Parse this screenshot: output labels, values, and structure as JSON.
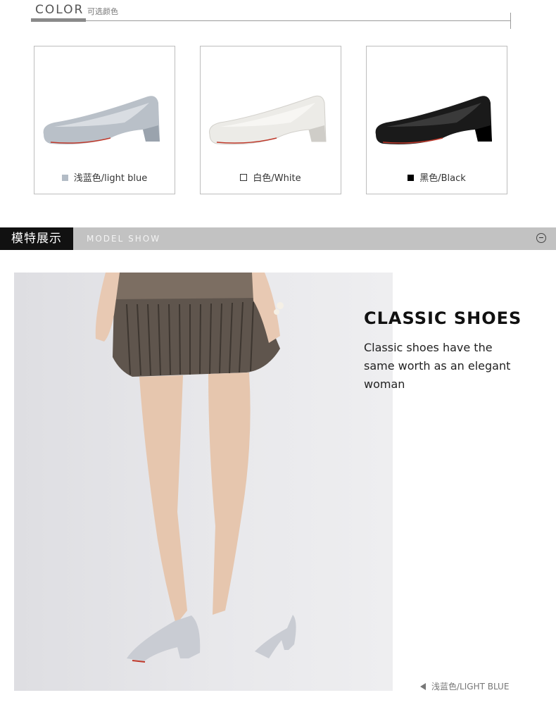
{
  "color_section": {
    "title": "COLOR",
    "subtitle": "可选颜色",
    "swatches": [
      {
        "label": "浅蓝色/light blue",
        "color": "#b3bcc6",
        "shoe_color": "#b9c0c8",
        "shoe_shadow": "#9aa3ad"
      },
      {
        "label": "白色/White",
        "color": "#ffffff",
        "shoe_color": "#ecebe7",
        "shoe_shadow": "#cfcdc8"
      },
      {
        "label": "黑色/Black",
        "color": "#000000",
        "shoe_color": "#1a1a1a",
        "shoe_shadow": "#000000"
      }
    ]
  },
  "model_section": {
    "title_cn": "模特展示",
    "title_en": "MODEL SHOW",
    "headline": "CLASSIC SHOES",
    "tagline": "Classic shoes have the same worth as an elegant woman",
    "caption": "浅蓝色/LIGHT BLUE"
  }
}
